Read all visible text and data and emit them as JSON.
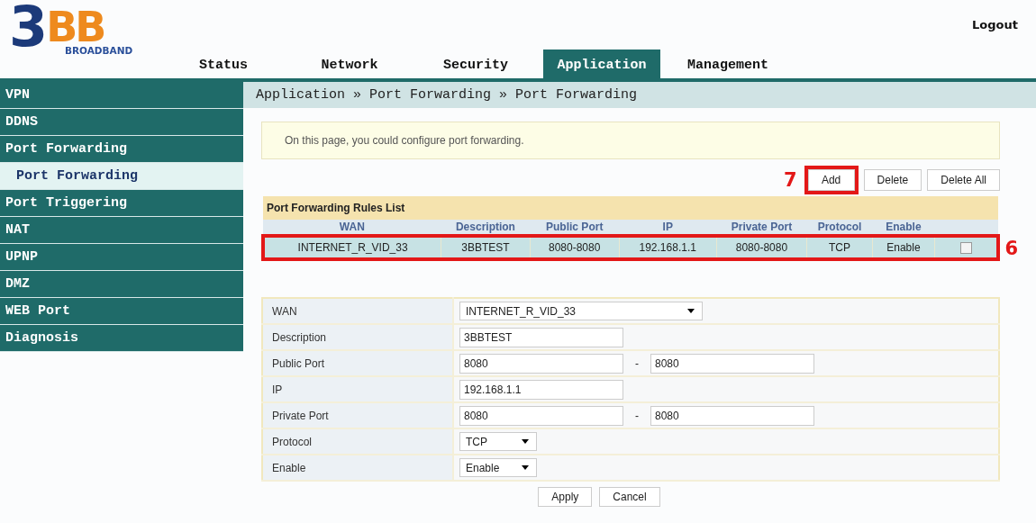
{
  "logo": {
    "mark": "3",
    "accent": "BB",
    "tagline": "BROADBAND"
  },
  "logout": "Logout",
  "tabs": [
    {
      "label": "Status",
      "selected": false
    },
    {
      "label": "Network",
      "selected": false
    },
    {
      "label": "Security",
      "selected": false
    },
    {
      "label": "Application",
      "selected": true
    },
    {
      "label": "Management",
      "selected": false
    }
  ],
  "sidebar": {
    "items": [
      {
        "label": "VPN",
        "selected": false
      },
      {
        "label": "DDNS",
        "selected": false
      },
      {
        "label": "Port Forwarding",
        "selected": false,
        "children": [
          {
            "label": "Port Forwarding",
            "selected": true
          }
        ]
      },
      {
        "label": "Port Triggering",
        "selected": false
      },
      {
        "label": "NAT",
        "selected": false
      },
      {
        "label": "UPNP",
        "selected": false
      },
      {
        "label": "DMZ",
        "selected": false
      },
      {
        "label": "WEB Port",
        "selected": false
      },
      {
        "label": "Diagnosis",
        "selected": false
      }
    ]
  },
  "breadcrumb": "Application » Port Forwarding » Port Forwarding",
  "info": "On this page, you could configure port forwarding.",
  "list_buttons": [
    {
      "label": "Add",
      "callout": "7"
    },
    {
      "label": "Delete"
    },
    {
      "label": "Delete All"
    }
  ],
  "rules": {
    "title": "Port Forwarding Rules List",
    "columns": [
      "WAN",
      "Description",
      "Public Port",
      "IP",
      "Private Port",
      "Protocol",
      "Enable"
    ],
    "rows": [
      {
        "cells": [
          "INTERNET_R_VID_33",
          "3BBTEST",
          "8080-8080",
          "192.168.1.1",
          "8080-8080",
          "TCP",
          "Enable"
        ],
        "checked": false,
        "callout": "6"
      }
    ]
  },
  "form": [
    {
      "label": "WAN",
      "kind": "combo",
      "value": "INTERNET_R_VID_33"
    },
    {
      "label": "Description",
      "kind": "text",
      "value": "3BBTEST"
    },
    {
      "label": "Public Port",
      "kind": "range",
      "value": "8080",
      "separator": "-",
      "value_to": "8080"
    },
    {
      "label": "IP",
      "kind": "text",
      "value": "192.168.1.1"
    },
    {
      "label": "Private Port",
      "kind": "range",
      "value": "8080",
      "separator": "-",
      "value_to": "8080"
    },
    {
      "label": "Protocol",
      "kind": "select",
      "value": "TCP"
    },
    {
      "label": "Enable",
      "kind": "select",
      "value": "Enable"
    }
  ],
  "form_buttons": [
    "Apply",
    "Cancel"
  ]
}
